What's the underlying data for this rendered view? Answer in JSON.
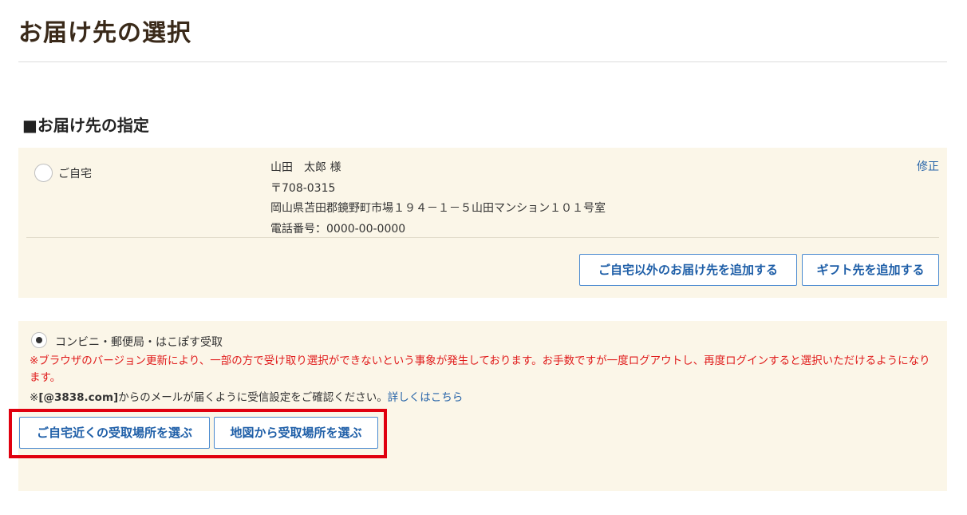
{
  "page": {
    "title": "お届け先の選択"
  },
  "section": {
    "heading": "■お届け先の指定"
  },
  "home_option": {
    "label": "ご自宅",
    "selected": false,
    "address": {
      "name": "山田　太郎 様",
      "postal": "〒708-0315",
      "street": "岡山県苫田郡鏡野町市場１９４－１－５山田マンション１０１号室",
      "phone": "電話番号：0000-00-0000"
    },
    "edit_label": "修正",
    "add_other_label": "ご自宅以外のお届け先を追加する",
    "add_gift_label": "ギフト先を追加する"
  },
  "pickup_option": {
    "label": "コンビニ・郵便局・はこぽす受取",
    "selected": true,
    "notice_red": "※ブラウザのバージョン更新により、一部の方で受け取り選択ができないという事象が発生しております。お手数ですが一度ログアウトし、再度ログインすると選択いただけるようになります。",
    "mail_prefix": "※",
    "mail_domain": "[@3838.com]",
    "mail_text": "からのメールが届くように受信設定をご確認ください。",
    "mail_link": "詳しくはこちら",
    "nearby_button_label": "ご自宅近くの受取場所を選ぶ",
    "map_button_label": "地図から受取場所を選ぶ"
  },
  "colors": {
    "panel_bg": "#fbf6e8",
    "link": "#2563a8",
    "button_border": "#4a8ad0",
    "warning": "#e01b1b",
    "highlight": "#e0000f"
  }
}
